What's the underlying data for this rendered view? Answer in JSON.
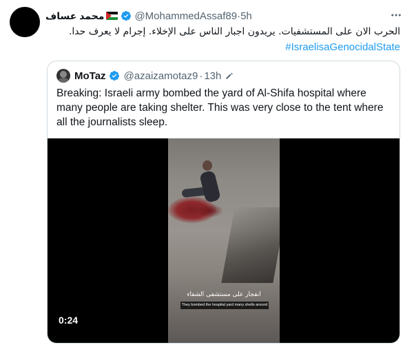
{
  "tweet": {
    "author_name": "محمد عساف",
    "handle": "@MohammedAssaf89",
    "separator": " · ",
    "time": "5h",
    "text": "الحرب الان على المستشفيات. يريدون اجبار  الناس على الإخلاء. إجرام لا يعرف حدا.",
    "hashtag": "#IsraelisaGenocidalState",
    "more_icon": "more-horizontal-icon"
  },
  "quote": {
    "author_name": "MoTaz",
    "handle": "@azaizamotaz9",
    "separator": " · ",
    "time": "13h",
    "edited_icon": "pencil-icon",
    "text": "Breaking: Israeli army bombed the yard of Al-Shifa hospital where many people are taking shelter. This was very close to the tent where all the journalists sleep.",
    "video": {
      "caption_ar": "انفجار على مستشفى الشفاء",
      "caption_en": "They bombed the hospital yard many shells around",
      "timestamp": "0:24"
    }
  },
  "colors": {
    "text": "#0f1419",
    "secondary": "#536471",
    "accent": "#1d9bf0",
    "border": "#cfd9de"
  }
}
